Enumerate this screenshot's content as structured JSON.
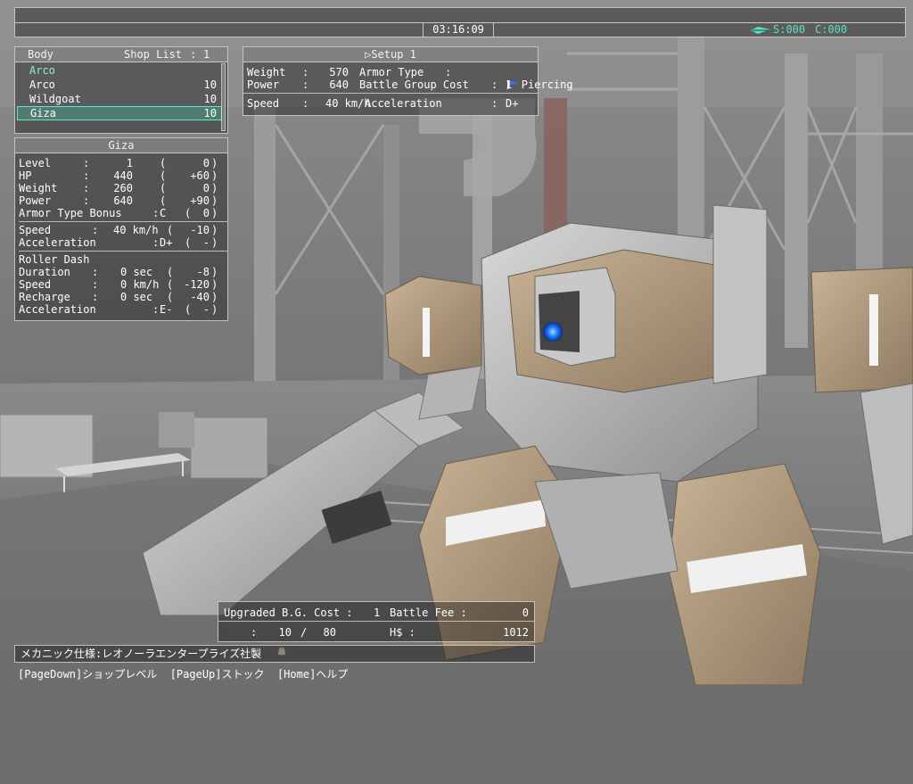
{
  "hud": {
    "clock": "03:16:09",
    "currency": {
      "s_value": "S:000",
      "c_value": "C:000",
      "color": "#59e0c8"
    }
  },
  "shop": {
    "col_body": "Body",
    "col_shop_list": "Shop List",
    "col_sep": ":",
    "col_count": "1",
    "header_item": "Arco",
    "items": [
      {
        "name": "Arco",
        "qty": "10"
      },
      {
        "name": "Wildgoat",
        "qty": "10"
      },
      {
        "name": "Giza",
        "qty": "10"
      }
    ],
    "selected_index": 2,
    "accent_color": "#5fe6c8"
  },
  "detail": {
    "title": "Giza",
    "stats": [
      {
        "label": "Level",
        "sep": ":",
        "value": "1",
        "open": "(",
        "delta": "0",
        "close": ")"
      },
      {
        "label": "HP",
        "sep": ":",
        "value": "440",
        "open": "(",
        "delta": "+60",
        "close": ")"
      },
      {
        "label": "Weight",
        "sep": ":",
        "value": "260",
        "open": "(",
        "delta": "0",
        "close": ")"
      },
      {
        "label": "Power",
        "sep": ":",
        "value": "640",
        "open": "(",
        "delta": "+90",
        "close": ")"
      }
    ],
    "armor_bonus": {
      "label": "Armor Type Bonus",
      "sep": ":",
      "value": "C",
      "open": "(",
      "delta": "0",
      "close": ")"
    },
    "speed": {
      "label": "Speed",
      "sep": ":",
      "value": "40 km/h",
      "open": "(",
      "delta": "-10",
      "close": ")"
    },
    "acceleration": {
      "label": "Acceleration",
      "sep": ":",
      "value": "D+",
      "open": "(",
      "delta": "-",
      "close": ")"
    },
    "roller_dash": {
      "title": "Roller Dash",
      "rows": [
        {
          "label": "Duration",
          "sep": ":",
          "value": "0 sec",
          "open": "(",
          "delta": "-8",
          "close": ")"
        },
        {
          "label": "Speed",
          "sep": ":",
          "value": "0 km/h",
          "open": "(",
          "delta": "-120",
          "close": ")"
        },
        {
          "label": "Recharge",
          "sep": ":",
          "value": "0 sec",
          "open": "(",
          "delta": "-40",
          "close": ")"
        }
      ],
      "acceleration": {
        "label": "Acceleration",
        "sep": ":",
        "value": "E-",
        "open": "(",
        "delta": "-",
        "close": ")"
      }
    }
  },
  "setup": {
    "title": "Setup 1",
    "weight_label": "Weight",
    "weight_value": "570",
    "armor_type_label": "Armor Type",
    "armor_type_value": "Piercing",
    "power_label": "Power",
    "power_value": "640",
    "bg_cost_label": "Battle Group Cost",
    "bg_cost_value": "1",
    "speed_label": "Speed",
    "speed_value": "40 km/h",
    "accel_label": "Acceleration",
    "accel_value": "D+",
    "sep": ":"
  },
  "cost": {
    "upgraded_label": "Upgraded B.G. Cost :",
    "upgraded_value": "1",
    "battle_fee_label": "Battle Fee :",
    "battle_fee_value": "0",
    "bag_sep": ":",
    "bag_current": "10",
    "bag_slash": "/",
    "bag_max": "80",
    "hs_label": "H$ :",
    "hs_value": "1012"
  },
  "mechanic_spec": "メカニック仕様:レオノーラエンタープライズ社製",
  "help": "[PageDown]ショップレベル  [PageUp]ストック  [Home]ヘルプ"
}
